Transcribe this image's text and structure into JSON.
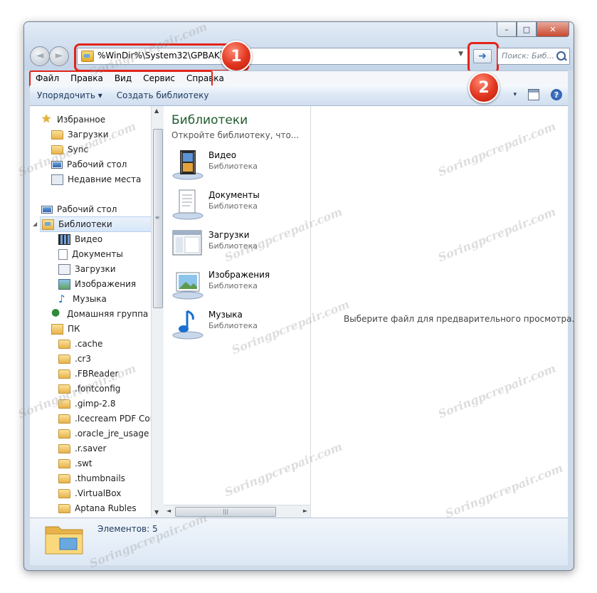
{
  "window": {
    "caption_buttons": {
      "minimize": "–",
      "maximize": "□",
      "close": "✕"
    },
    "nav": {
      "back": "◄",
      "forward": "►"
    },
    "address": {
      "value": "%WinDir%\\System32\\GPBAK",
      "dropdown": "▼",
      "go_label": "➜"
    },
    "search": {
      "placeholder": "Поиск: Биб..."
    },
    "callouts": [
      "1",
      "2"
    ]
  },
  "menubar": {
    "items": [
      "Файл",
      "Правка",
      "Вид",
      "Сервис",
      "Справка"
    ]
  },
  "toolbar": {
    "organize": "Упорядочить ▾",
    "create_library": "Создать библиотеку",
    "views_arrow": "▾",
    "help": "?"
  },
  "nav_tree": {
    "favorites": "Избранное",
    "downloads": "Загрузки",
    "sync": "Sync",
    "desktop_fav": "Рабочий стол",
    "recent": "Недавние места",
    "desktop": "Рабочий стол",
    "libraries": "Библиотеки",
    "video": "Видео",
    "documents": "Документы",
    "downloads2": "Загрузки",
    "images": "Изображения",
    "music": "Музыка",
    "homegroup": "Домашняя группа",
    "pc": "ПК",
    "folders": [
      ".cache",
      ".cr3",
      ".FBReader",
      ".fontconfig",
      ".gimp-2.8",
      ".Icecream PDF Conv",
      ".oracle_jre_usage",
      ".r.saver",
      ".swt",
      ".thumbnails",
      ".VirtualBox",
      "Aptana Rubles"
    ]
  },
  "libraries": {
    "title": "Библиотеки",
    "subtitle": "Откройте библиотеку, чтo...",
    "items": [
      {
        "name": "Видео",
        "type": "Библиотека"
      },
      {
        "name": "Документы",
        "type": "Библиотека"
      },
      {
        "name": "Загрузки",
        "type": "Библиотека"
      },
      {
        "name": "Изображения",
        "type": "Библиотека"
      },
      {
        "name": "Музыка",
        "type": "Библиотека"
      }
    ]
  },
  "preview": {
    "text": "Выберите файл для предварительного просмотра."
  },
  "details": {
    "count": "Элементов: 5"
  },
  "watermark": "Soringpcrepair.com",
  "colors": {
    "callout": "#e2231a",
    "library_title": "#1e5b2e",
    "toolbar_text": "#1e395b"
  }
}
